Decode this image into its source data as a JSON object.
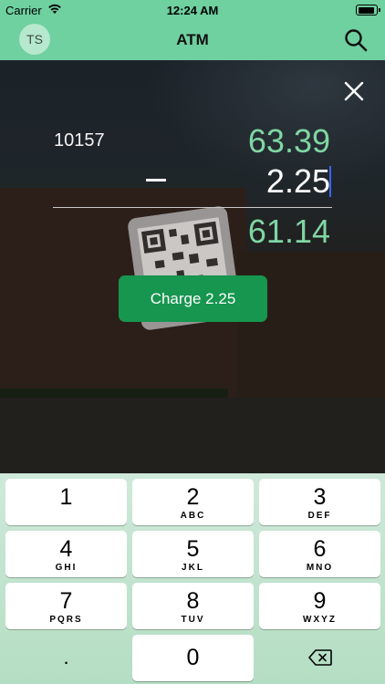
{
  "status_bar": {
    "carrier": "Carrier",
    "time": "12:24 AM"
  },
  "nav": {
    "avatar_initials": "TS",
    "title": "ATM",
    "search_icon": "search-icon"
  },
  "transaction": {
    "account_number": "10157",
    "balance": "63.39",
    "operator": "minus",
    "charge_amount": "2.25",
    "result": "61.14",
    "charge_button_label": "Charge 2.25"
  },
  "colors": {
    "accent_green": "#6fd0a0",
    "button_green": "#16964f",
    "amount_green": "#7fd6a3",
    "cursor_blue": "#3c63ff"
  },
  "keypad": {
    "keys": [
      {
        "digit": "1",
        "letters": ""
      },
      {
        "digit": "2",
        "letters": "ABC"
      },
      {
        "digit": "3",
        "letters": "DEF"
      },
      {
        "digit": "4",
        "letters": "GHI"
      },
      {
        "digit": "5",
        "letters": "JKL"
      },
      {
        "digit": "6",
        "letters": "MNO"
      },
      {
        "digit": "7",
        "letters": "PQRS"
      },
      {
        "digit": "8",
        "letters": "TUV"
      },
      {
        "digit": "9",
        "letters": "WXYZ"
      },
      {
        "digit": ".",
        "letters": ""
      },
      {
        "digit": "0",
        "letters": ""
      }
    ],
    "delete_icon": "backspace-icon"
  }
}
